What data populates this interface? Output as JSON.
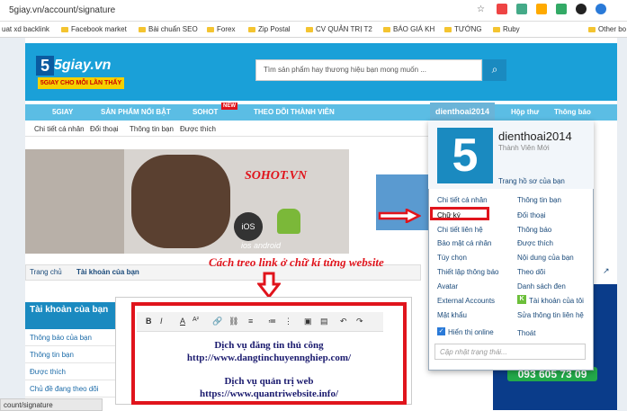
{
  "browser": {
    "url": "5giay.vn/account/signature",
    "bookmarks": [
      "uat xd backlink",
      "Facebook market",
      "Bài chuẩn SEO",
      "Forex",
      "Zip Postal",
      "CV QUẢN TRỊ T2",
      "BÁO GIÁ KH",
      "TƯỚNG",
      "Ruby",
      "Other bo"
    ]
  },
  "header": {
    "logo_text": "5giay.vn",
    "logo_slogan": "5GIAY CHO MỖI LẦN THẤY",
    "search_placeholder": "Tìm sản phẩm hay thương hiệu bạn mong muốn ...",
    "nav": [
      "5GIAY",
      "SẢN PHẨM NỔI BẬT",
      "SOHOT",
      "THEO DÕI THÀNH VIÊN"
    ],
    "new_badge": "NEW",
    "user": "dienthoai2014",
    "inbox": "Hộp thư",
    "alerts": "Thông báo"
  },
  "subnav": [
    "Chi tiết cá nhân",
    "Đổi thoại",
    "Thông tin bạn",
    "Được thích"
  ],
  "banner": {
    "brand": "SOHOT.VN",
    "os1": "iOS",
    "os2": "ios android"
  },
  "breadcrumb": [
    "Trang chủ",
    "Tài khoản của bạn"
  ],
  "annotation": "Cách treo link ở chữ kí từng website",
  "sidebar": {
    "title": "Tài khoản của bạn",
    "items": [
      "Thông báo của bạn",
      "Thông tin bạn",
      "Được thích",
      "Chủ đề đang theo dõi"
    ]
  },
  "editor": {
    "toolbar": [
      "B",
      "I",
      "A",
      "A²",
      "🔗",
      "⛓",
      "≡",
      "≔",
      "⋮",
      "▣",
      "▤",
      "↶",
      "↷"
    ],
    "lines": [
      "Dịch vụ đăng tin thủ công",
      "http://www.dangtinchuyennghiep.com/",
      "Dịch vụ quản trị web",
      "https://www.quantriwebsite.info/"
    ]
  },
  "dropdown": {
    "username": "dienthoai2014",
    "rank": "Thành Viên Mới",
    "profile_link": "Trang hồ sơ của bạn",
    "left": [
      "Chi tiết cá nhân",
      "Chữ ký",
      "Chi tiết liên hệ",
      "Bảo mật cá nhân",
      "Tùy chọn",
      "Thiết lập thông báo",
      "Avatar",
      "External Accounts",
      "Mật khẩu"
    ],
    "right": [
      "Thông tin bạn",
      "Đối thoại",
      "Thông báo",
      "Được thích",
      "Nội dung của bạn",
      "Theo dõi",
      "Danh sách đen",
      "Tài khoản của tôi",
      "Sửa thông tin liên hệ",
      "Thoát"
    ],
    "online": "Hiển thị online",
    "status_placeholder": "Cập nhật trạng thái..."
  },
  "ad": {
    "phone": "093 605 73 09"
  },
  "status_url": "count/signature"
}
